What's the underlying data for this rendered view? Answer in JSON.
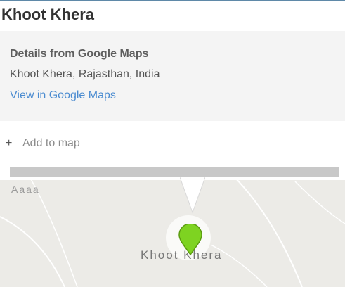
{
  "card": {
    "title": "Khoot Khera",
    "details_heading": "Details from Google Maps",
    "address": "Khoot Khera, Rajasthan, India",
    "maps_link": "View in Google Maps",
    "add_to_map": "Add to map"
  },
  "map": {
    "top_label": "Aaaa",
    "place_label": "Khoot Khera",
    "pin_color": "#7ed321",
    "background_color": "#ecebe7"
  },
  "icons": {
    "add": "plus-icon",
    "pin": "map-pin-icon"
  },
  "colors": {
    "link": "#4a8bd0",
    "divider": "#c8c8c8"
  }
}
